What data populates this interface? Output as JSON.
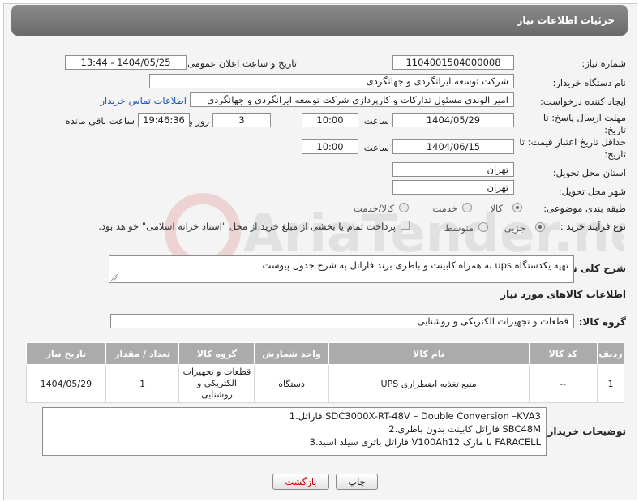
{
  "header": {
    "title": "جزئیات اطلاعات نیاز"
  },
  "fields": {
    "need_number": {
      "label": "شماره نیاز:",
      "value": "1104001504000008"
    },
    "announce_datetime": {
      "label": "تاریخ و ساعت اعلان عمومی:",
      "value": "1404/05/25 - 13:44"
    },
    "buyer_org": {
      "label": "نام دستگاه خریدار:",
      "value": "شرکت توسعه ایرانگردی و جهانگردی"
    },
    "requester": {
      "label": "ایجاد کننده درخواست:",
      "value": "امیر الوندی مسئول تدارکات و کارپردازی شرکت توسعه ایرانگردی و جهانگردی",
      "contact_link": "اطلاعات تماس خریدار"
    },
    "reply_deadline": {
      "label": "مهلت ارسال پاسخ: تا تاریخ:",
      "date": "1404/05/29",
      "time_label": "ساعت",
      "time": "10:00",
      "days": "3",
      "days_label": "روز و",
      "remaining": "19:46:36",
      "remaining_label": "ساعت باقی مانده"
    },
    "price_validity": {
      "label": "حداقل تاریخ اعتبار قیمت: تا تاریخ:",
      "date": "1404/06/15",
      "time_label": "ساعت",
      "time": "10:00"
    },
    "delivery_province": {
      "label": "استان محل تحویل:",
      "value": "تهران"
    },
    "delivery_city": {
      "label": "شهر محل تحویل:",
      "value": "تهران"
    },
    "category": {
      "label": "طبقه بندی موضوعی:",
      "options": [
        "کالا",
        "خدمت",
        "کالا/خدمت"
      ],
      "selected": "کالا"
    },
    "process_type": {
      "label": "نوع فرآیند خرید :",
      "options": [
        "جزیی",
        "متوسط"
      ],
      "selected": "جزیی",
      "note": "پرداخت تمام یا بخشی از مبلغ خرید،از محل \"اسناد خزانه اسلامی\" خواهد بود."
    }
  },
  "summary": {
    "label": "شرح کلی نیاز:",
    "value": "تهیه یکدستگاه ups به همراه کابینت و باطری برند فاراتل به شرح جدول پیوست"
  },
  "goods_section": {
    "title": "اطلاعات کالاهای مورد نیاز",
    "group_label": "گروه کالا:",
    "group_value": "قطعات و تجهیزات الکتریکی و روشنایی"
  },
  "table": {
    "headers": [
      "ردیف",
      "کد کالا",
      "نام کالا",
      "واحد شمارش",
      "گروه کالا",
      "تعداد / مقدار",
      "تاریخ نیاز"
    ],
    "rows": [
      [
        "1",
        "--",
        "منبع تغذیه اضطراری UPS",
        "دستگاه",
        "قطعات و تجهیزات الکتریکی و روشنایی",
        "1",
        "1404/05/29"
      ]
    ]
  },
  "buyer_notes": {
    "label": "توضیحات خریدار:",
    "lines": [
      "1.فاراتل SDC3000X-RT-48V – Double Conversion –KVA3",
      "2.فاراتل کابینت بدون باطری SBC48M",
      "3.فاراتل باتری سیلد اسید V100Ah12 با مارک FARACELL"
    ]
  },
  "buttons": {
    "print": "چاپ",
    "back": "بازگشت"
  },
  "watermark": {
    "text": "AriaTender.net"
  },
  "colors": {
    "header_bg": "#777777",
    "link": "#1a56b8",
    "back_button_text": "#cc0000",
    "table_header_bg": "#ababab"
  }
}
